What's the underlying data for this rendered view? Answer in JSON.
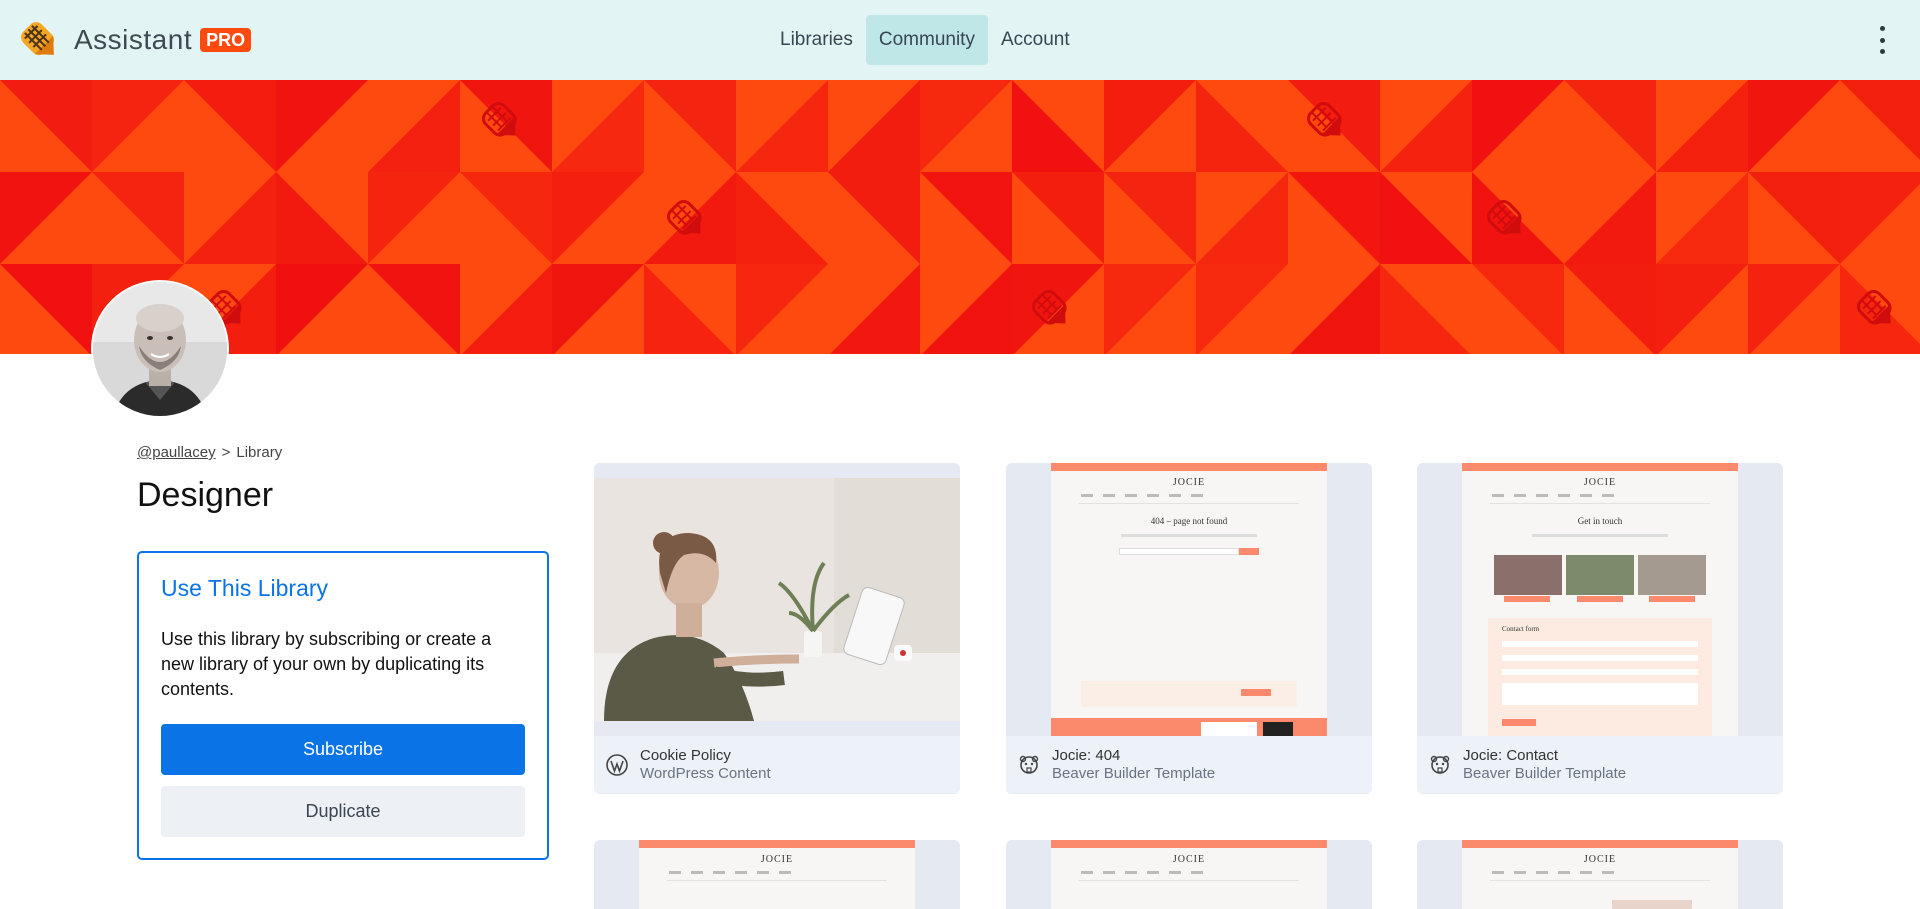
{
  "app": {
    "name": "Assistant",
    "badge": "PRO"
  },
  "nav": {
    "items": [
      {
        "label": "Libraries",
        "active": false
      },
      {
        "label": "Community",
        "active": true
      },
      {
        "label": "Account",
        "active": false
      }
    ],
    "menu_icon": "kebab-menu-icon"
  },
  "colors": {
    "brand_orange": "#ff4a0f",
    "banner_red": "#f01010",
    "primary_blue": "#0a74e6",
    "nav_bg": "#e2f4f4",
    "nav_active": "#bfe7e8"
  },
  "profile": {
    "handle": "@paullacey",
    "crumb_separator": ">",
    "crumb_current": "Library",
    "library_title": "Designer"
  },
  "use_library": {
    "heading": "Use This Library",
    "description": "Use this library by subscribing or create a new library of your own by duplicating its contents.",
    "subscribe_label": "Subscribe",
    "duplicate_label": "Duplicate"
  },
  "items": [
    {
      "name": "Cookie Policy",
      "type": "WordPress Content",
      "icon": "wordpress-icon"
    },
    {
      "name": "Jocie: 404",
      "type": "Beaver Builder Template",
      "icon": "beaver-builder-icon"
    },
    {
      "name": "Jocie: Contact",
      "type": "Beaver Builder Template",
      "icon": "beaver-builder-icon"
    }
  ],
  "previews": {
    "site_logo": "JOCIE",
    "page_404_heading": "404 – page not found",
    "contact_heading": "Get in touch",
    "contact_form_label": "Contact form"
  }
}
